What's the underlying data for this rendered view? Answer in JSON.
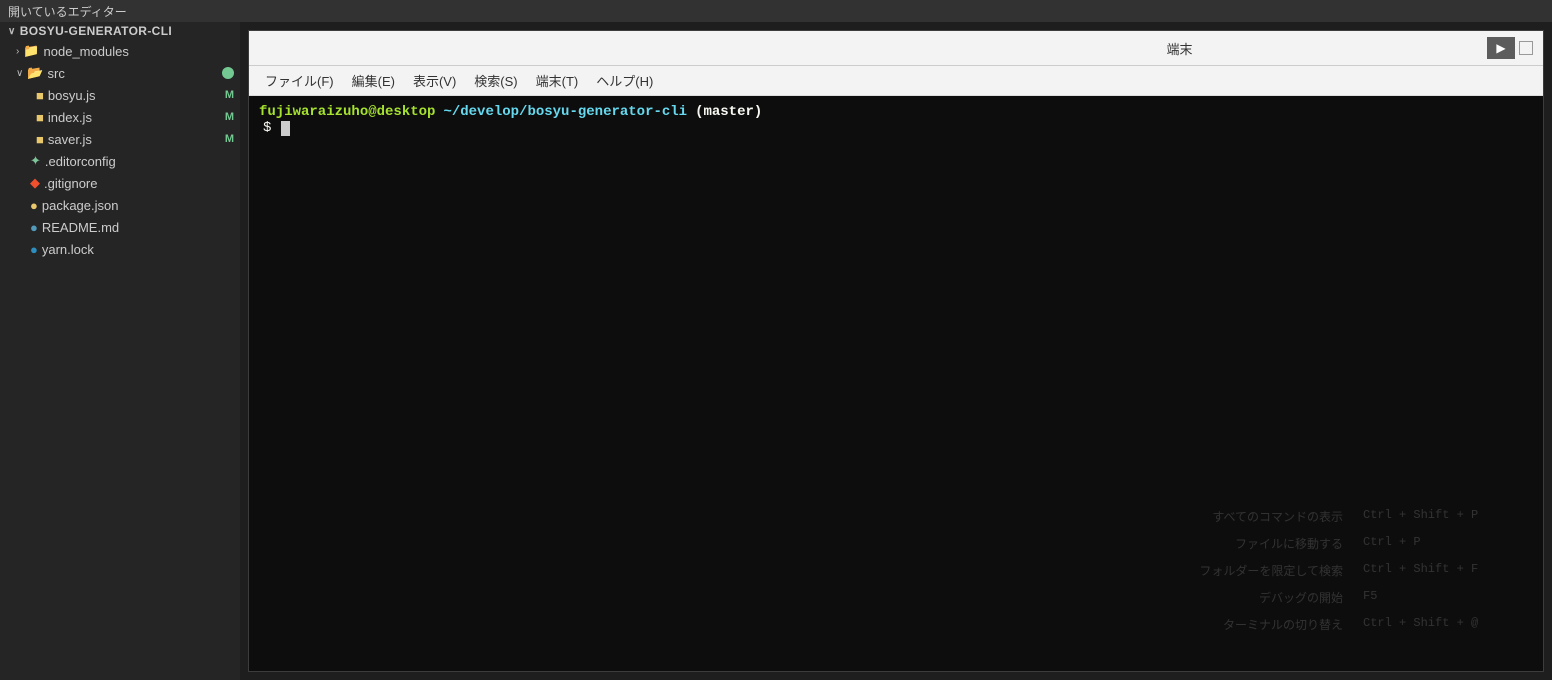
{
  "topbar": {
    "label": "開いているエディター"
  },
  "sidebar": {
    "project": {
      "name": "BOSYU-GENERATOR-CLI",
      "chevron": "∨"
    },
    "items": [
      {
        "id": "node_modules",
        "label": "node_modules",
        "type": "folder",
        "indent": 16,
        "badge": "",
        "chevron": "›"
      },
      {
        "id": "src",
        "label": "src",
        "type": "folder-open",
        "indent": 16,
        "badge": "",
        "chevron": "∨",
        "expanded": true
      },
      {
        "id": "bosyu.js",
        "label": "bosyu.js",
        "type": "js",
        "indent": 36,
        "badge": "M"
      },
      {
        "id": "index.js",
        "label": "index.js",
        "type": "js",
        "indent": 36,
        "badge": "M"
      },
      {
        "id": "saver.js",
        "label": "saver.js",
        "type": "js",
        "indent": 36,
        "badge": "M"
      },
      {
        "id": ".editorconfig",
        "label": ".editorconfig",
        "type": "editorconfig",
        "indent": 16,
        "badge": ""
      },
      {
        "id": ".gitignore",
        "label": ".gitignore",
        "type": "gitignore",
        "indent": 16,
        "badge": ""
      },
      {
        "id": "package.json",
        "label": "package.json",
        "type": "json",
        "indent": 16,
        "badge": ""
      },
      {
        "id": "README.md",
        "label": "README.md",
        "type": "md",
        "indent": 16,
        "badge": ""
      },
      {
        "id": "yarn.lock",
        "label": "yarn.lock",
        "type": "yarn",
        "indent": 16,
        "badge": ""
      }
    ]
  },
  "terminal": {
    "title": "端末",
    "menus": [
      "ファイル(F)",
      "編集(E)",
      "表示(V)",
      "検索(S)",
      "端末(T)",
      "ヘルプ(H)"
    ],
    "prompt": {
      "user": "fujiwaraizuho@desktop",
      "path": "~/develop/bosyu-generator-cli",
      "branch": "(master)",
      "dollar": "$"
    },
    "hints": [
      {
        "label": "すべてのコマンドの表示",
        "key": "Ctrl + Shift + P"
      },
      {
        "label": "ファイルに移動する",
        "key": "Ctrl + P"
      },
      {
        "label": "フォルダーを限定して検索",
        "key": "Ctrl + Shift + F"
      },
      {
        "label": "デバッグの開始",
        "key": "F5"
      },
      {
        "label": "ターミナルの切り替え",
        "key": "Ctrl + Shift + @"
      }
    ]
  }
}
